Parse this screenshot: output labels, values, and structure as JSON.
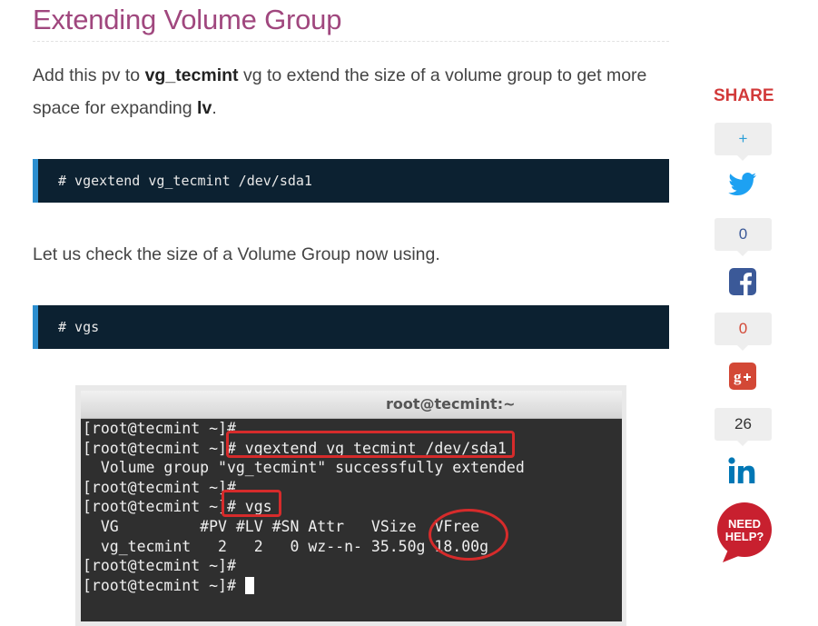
{
  "article": {
    "heading": "Extending Volume Group",
    "para1": {
      "pre": "Add this pv to ",
      "bold1": "vg_tecmint",
      "mid": " vg to extend the size of a volume group to get more space for expanding ",
      "bold2": "lv",
      "post": "."
    },
    "code1": "# vgextend vg_tecmint /dev/sda1",
    "para2": "Let us check the size of a Volume Group now using.",
    "code2": "# vgs"
  },
  "screenshot": {
    "window_title": "root@tecmint:~",
    "lines": [
      "[root@tecmint ~]#",
      "[root@tecmint ~]# vgextend vg_tecmint /dev/sda1",
      "  Volume group \"vg_tecmint\" successfully extended",
      "[root@tecmint ~]#",
      "[root@tecmint ~]# vgs",
      "  VG         #PV #LV #SN Attr   VSize  VFree",
      "  vg_tecmint   2   2   0 wz--n- 35.50g 18.00g",
      "[root@tecmint ~]#",
      "[root@tecmint ~]# "
    ]
  },
  "share": {
    "title": "SHARE",
    "twitter_count": "+",
    "facebook_count": "0",
    "googleplus_count": "0",
    "linkedin_count": "26",
    "help_label_1": "NEED",
    "help_label_2": "HELP?",
    "colors": {
      "twitter": "#1da1f2",
      "facebook": "#3b5998",
      "googleplus": "#d34836",
      "linkedin": "#0077b5",
      "help": "#c8202f"
    }
  }
}
